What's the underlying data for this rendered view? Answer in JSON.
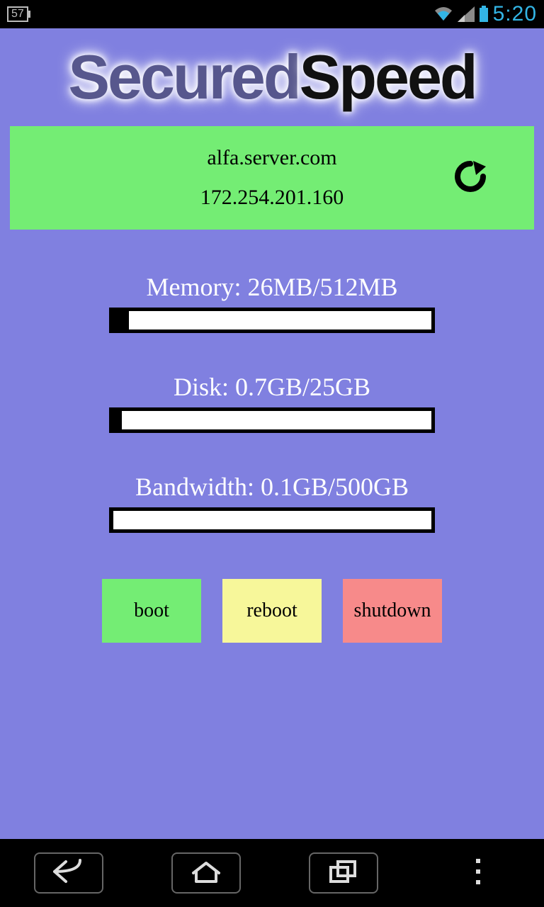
{
  "status_bar": {
    "battery_pct": "57",
    "time": "5:20",
    "icons": {
      "wifi": "wifi-icon",
      "signal": "signal-icon",
      "battery": "battery-icon"
    }
  },
  "logo": {
    "part1": "Secured",
    "part2": "Speed"
  },
  "server": {
    "host": "alfa.server.com",
    "ip": "172.254.201.160",
    "refresh_icon": "refresh-icon"
  },
  "metrics": {
    "memory": {
      "label": "Memory:  26MB/512MB",
      "used": 26,
      "total": 512
    },
    "disk": {
      "label": "Disk:  0.7GB/25GB",
      "used": 0.7,
      "total": 25
    },
    "bandwidth": {
      "label": "Bandwidth:  0.1GB/500GB",
      "used": 0.1,
      "total": 500
    }
  },
  "actions": {
    "boot": "boot",
    "reboot": "reboot",
    "shutdown": "shutdown"
  },
  "nav": {
    "back": "back-icon",
    "home": "home-icon",
    "recent": "recent-icon",
    "menu": "menu-icon"
  },
  "colors": {
    "bg": "#8080e0",
    "panel": "#74ed74",
    "boot": "#74ed74",
    "reboot": "#f7f79a",
    "shutdown": "#f78a8a",
    "accent": "#33b5e5"
  }
}
